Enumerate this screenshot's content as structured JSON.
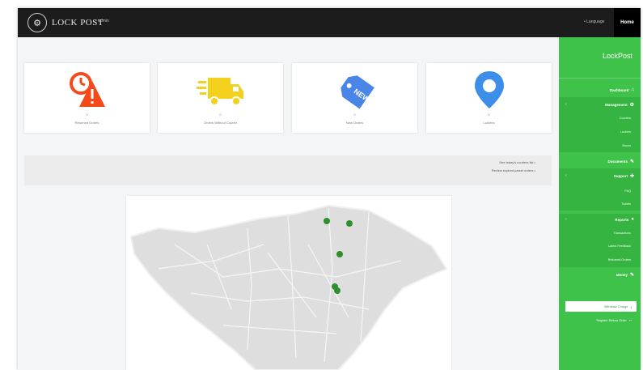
{
  "header": {
    "logo_text": "LOCK POST",
    "user": "• admin",
    "language": "• Language",
    "home_tab": "Home"
  },
  "sidebar": {
    "title": "LockPost",
    "items": [
      {
        "label": "Dashboard",
        "icon": "home-icon"
      },
      {
        "label": "Management",
        "icon": "gear-icon"
      },
      {
        "label": "Couriers",
        "icon": "dot-icon",
        "sub": true
      },
      {
        "label": "Lockers",
        "icon": "dot-icon",
        "sub": true
      },
      {
        "label": "Boxes",
        "icon": "dot-icon",
        "sub": true
      },
      {
        "label": "Documents",
        "icon": "pin-icon"
      },
      {
        "label": "Support",
        "icon": "tag-icon"
      },
      {
        "label": "FAQ",
        "sub": true
      },
      {
        "label": "Tickets",
        "sub": true
      },
      {
        "label": "Reports",
        "icon": "chart-icon"
      },
      {
        "label": "Transactions",
        "sub": true
      },
      {
        "label": "Latest Feedback",
        "sub": true
      },
      {
        "label": "Returned Orders",
        "sub": true
      },
      {
        "label": "Money",
        "icon": "pen-icon"
      }
    ],
    "btn_white": "Withdraw Charge",
    "btn_green": "Register Return Order"
  },
  "cards": [
    {
      "count": "0",
      "label": "Returned Orders",
      "icon": "returned-warning-icon",
      "color": "#f44a1b"
    },
    {
      "count": "0",
      "label": "Orders Without Courier",
      "icon": "delivery-truck-icon",
      "color": "#f4d11d"
    },
    {
      "count": "0",
      "label": "New Orders",
      "icon": "new-tag-icon",
      "color": "#4a86e8"
    },
    {
      "count": "0",
      "label": "Lockers",
      "icon": "location-pin-icon",
      "color": "#3c8ee8"
    }
  ],
  "links": [
    "See today's couriers list  •",
    "Review expired parcel orders  •"
  ],
  "colors": {
    "sidebar_bg": "#3ec24a",
    "topbar_bg": "#1c1c1c",
    "map_land": "#dedede",
    "marker": "#2f8f2f"
  }
}
